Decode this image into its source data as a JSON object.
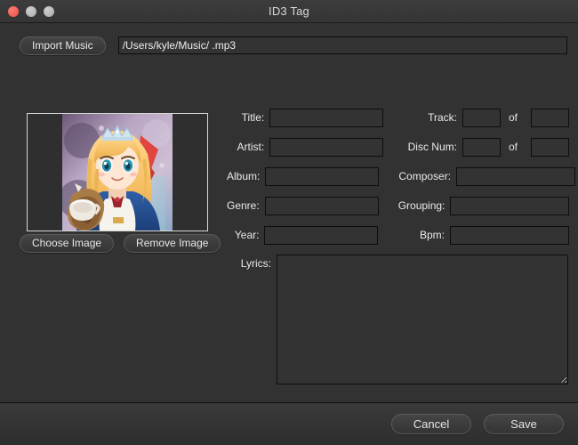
{
  "window": {
    "title": "ID3 Tag",
    "traffic_lights": [
      {
        "name": "close-button",
        "color": "#e8524a"
      },
      {
        "name": "minimize-button",
        "color": "#a9a9a9"
      },
      {
        "name": "maximize-button",
        "color": "#a9a9a9"
      }
    ]
  },
  "toolbar": {
    "import_label": "Import Music",
    "path_value": "/Users/kyle/Music/ .mp3",
    "path_placeholder": ""
  },
  "artwork": {
    "choose_label": "Choose Image",
    "remove_label": "Remove Image",
    "alt": "album-artwork-anime-character"
  },
  "form": {
    "title": {
      "label": "Title:",
      "value": "",
      "placeholder": ""
    },
    "artist": {
      "label": "Artist:",
      "value": "",
      "placeholder": ""
    },
    "album": {
      "label": "Album:",
      "value": "",
      "placeholder": ""
    },
    "genre": {
      "label": "Genre:",
      "value": "",
      "placeholder": ""
    },
    "year": {
      "label": "Year:",
      "value": "",
      "placeholder": ""
    },
    "track": {
      "label": "Track:",
      "value": "",
      "placeholder": ""
    },
    "track_total": {
      "value": "",
      "placeholder": ""
    },
    "disc_num": {
      "label": "Disc Num:",
      "value": "",
      "placeholder": ""
    },
    "disc_total": {
      "value": "",
      "placeholder": ""
    },
    "composer": {
      "label": "Composer:",
      "value": "",
      "placeholder": ""
    },
    "grouping": {
      "label": "Grouping:",
      "value": "",
      "placeholder": ""
    },
    "bpm": {
      "label": "Bpm:",
      "value": "",
      "placeholder": ""
    },
    "lyrics": {
      "label": "Lyrics:",
      "value": "",
      "placeholder": ""
    },
    "of_label": "of"
  },
  "footer": {
    "cancel_label": "Cancel",
    "save_label": "Save"
  },
  "colors": {
    "window_bg": "#323232",
    "titlebar_bg": "#3a3a3a",
    "field_bg": "#333333",
    "field_border": "#0d0d0d",
    "text": "#eaeaea",
    "close_red": "#e8524a"
  }
}
